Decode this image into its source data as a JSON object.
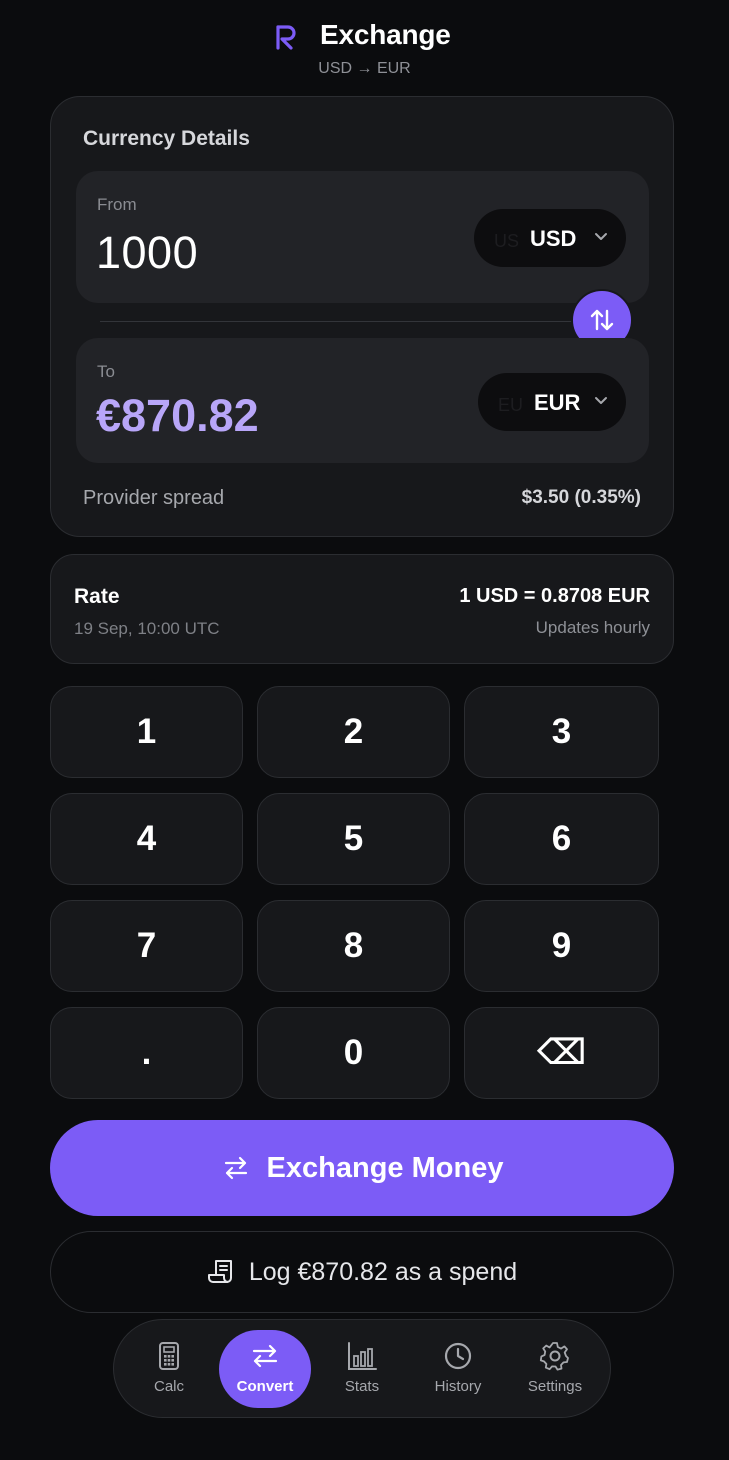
{
  "header": {
    "title": "Exchange",
    "subtitle": "USD → EUR",
    "logo_icon": "r-logo-icon",
    "accent": "#7c5cf6"
  },
  "details": {
    "title": "Currency Details",
    "from": {
      "label": "From",
      "amount": "1000",
      "flag": "US",
      "currency": "USD"
    },
    "to": {
      "label": "To",
      "amount": "€870.82",
      "flag": "EU",
      "currency": "EUR"
    },
    "swap_icon": "swap-vertical-icon",
    "spread_label": "Provider spread",
    "spread_value": "$3.50 (0.35%)"
  },
  "rate": {
    "label": "Rate",
    "timestamp": "19 Sep, 10:00 UTC",
    "value": "1 USD = 0.8708 EUR",
    "note": "Updates hourly"
  },
  "keypad": {
    "keys": [
      "1",
      "2",
      "3",
      "4",
      "5",
      "6",
      "7",
      "8",
      "9",
      ".",
      "0",
      "⌫"
    ]
  },
  "actions": {
    "exchange_label": "Exchange Money",
    "log_label": "Log €870.82 as a spend"
  },
  "nav": {
    "items": [
      {
        "label": "Calc",
        "icon": "calculator-icon"
      },
      {
        "label": "Convert",
        "icon": "swap-horizontal-icon",
        "active": true
      },
      {
        "label": "Stats",
        "icon": "bar-chart-icon"
      },
      {
        "label": "History",
        "icon": "clock-icon"
      },
      {
        "label": "Settings",
        "icon": "gear-icon"
      }
    ]
  }
}
